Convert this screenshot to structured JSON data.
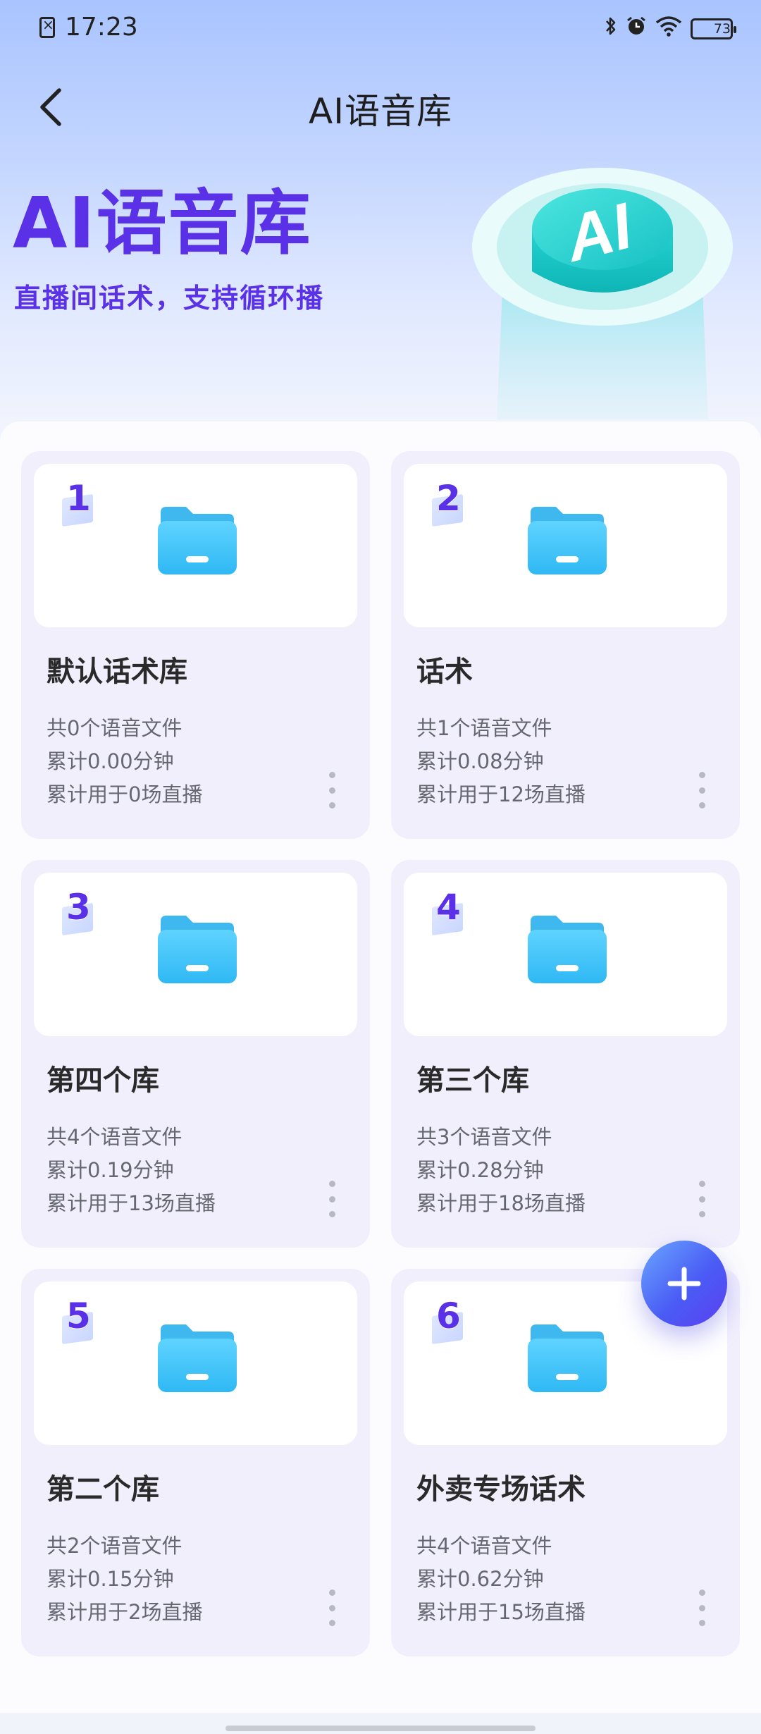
{
  "status_bar": {
    "time": "17:23",
    "bluetooth_icon": "bluetooth-icon",
    "alarm_icon": "alarm-icon",
    "wifi_icon": "wifi-icon",
    "battery_level": "73",
    "battery_fraction": 0.73
  },
  "nav": {
    "back_icon": "chevron-left-icon",
    "title": "AI语音库"
  },
  "hero": {
    "title": "AI语音库",
    "subtitle": "直播间话术，支持循环播",
    "badge_text": "AI"
  },
  "colors": {
    "accent": "#5a31e6",
    "folder": "#36c6f7",
    "fab": "#4a5cf5"
  },
  "libraries": [
    {
      "number": "1",
      "name": "默认话术库",
      "files": "共0个语音文件",
      "duration": "累计0.00分钟",
      "usage": "累计用于0场直播"
    },
    {
      "number": "2",
      "name": "话术",
      "files": "共1个语音文件",
      "duration": "累计0.08分钟",
      "usage": "累计用于12场直播"
    },
    {
      "number": "3",
      "name": "第四个库",
      "files": "共4个语音文件",
      "duration": "累计0.19分钟",
      "usage": "累计用于13场直播"
    },
    {
      "number": "4",
      "name": "第三个库",
      "files": "共3个语音文件",
      "duration": "累计0.28分钟",
      "usage": "累计用于18场直播"
    },
    {
      "number": "5",
      "name": "第二个库",
      "files": "共2个语音文件",
      "duration": "累计0.15分钟",
      "usage": "累计用于2场直播"
    },
    {
      "number": "6",
      "name": "外卖专场话术",
      "files": "共4个语音文件",
      "duration": "累计0.62分钟",
      "usage": "累计用于15场直播"
    }
  ],
  "fab": {
    "icon": "plus-icon"
  }
}
